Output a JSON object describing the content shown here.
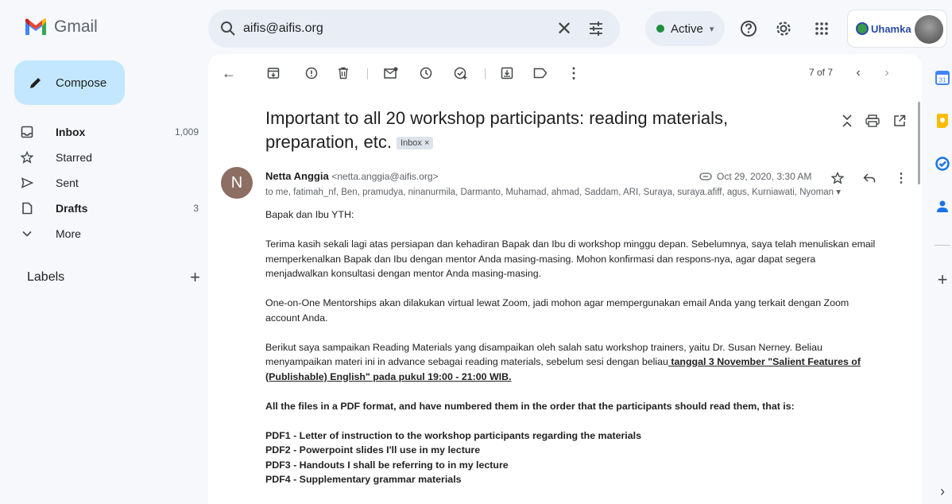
{
  "app": {
    "name": "Gmail"
  },
  "search": {
    "query": "aifis@aifis.org"
  },
  "status": {
    "label": "Active"
  },
  "account": {
    "org_logo_text": "Uhamka"
  },
  "sidebar": {
    "compose_label": "Compose",
    "items": [
      {
        "label": "Inbox",
        "count": "1,009",
        "icon": "inbox-icon"
      },
      {
        "label": "Starred",
        "count": "",
        "icon": "star-icon"
      },
      {
        "label": "Sent",
        "count": "",
        "icon": "send-icon"
      },
      {
        "label": "Drafts",
        "count": "3",
        "icon": "draft-icon"
      },
      {
        "label": "More",
        "count": "",
        "icon": "chevron-down-icon"
      }
    ],
    "labels_heading": "Labels"
  },
  "toolbar": {
    "pager": "7 of 7"
  },
  "email": {
    "subject_line1": "Important to all 20 workshop participants: reading materials,",
    "subject_line2": "preparation, etc.",
    "label_chip": "Inbox",
    "label_chip_close": "×",
    "sender_initial": "N",
    "sender_name": "Netta Anggia",
    "sender_email": "<netta.anggia@aifis.org>",
    "date": "Oct 29, 2020, 3:30 AM",
    "recipients": "to me, fatimah_nf, Ben, pramudya, ninanurmila, Darmanto, Muhamad, ahmad, Saddam, ARI, Suraya, suraya.afiff, agus, Kurniawati, Nyoman",
    "greeting": "Bapak dan Ibu YTH:",
    "p1_l1": "Terima kasih sekali lagi atas persiapan dan kehadiran Bapak dan Ibu di workshop minggu depan. Sebelumnya, saya telah menuliskan email",
    "p1_l2": "memperkenalkan Bapak dan Ibu dengan mentor Anda masing-masing. Mohon konfirmasi dan respons-nya, agar dapat segera",
    "p1_l3": "menjadwalkan konsultasi dengan mentor Anda masing-masing.",
    "p2_l1": "One-on-One Mentorships akan dilakukan virtual lewat Zoom, jadi mohon agar mempergunakan email Anda yang terkait dengan Zoom",
    "p2_l2": "account Anda.",
    "p3_l1": "Berikut saya sampaikan Reading Materials yang disampaikan oleh salah satu workshop trainers, yaitu Dr. Susan Nerney. Beliau",
    "p3_l2a": "menyampaikan materi ini in advance sebagai reading materials, sebelum sesi dengan beliau",
    "p3_l2b": " tanggal 3 November  \"Salient Features of",
    "p3_l3": "(Publishable) English\" pada pukul 19:00 - 21:00 WIB.",
    "p4": "All the files in a PDF format, and have numbered them in the order that the participants should read them, that is:",
    "pdfs": [
      "PDF1 - Letter of instruction to the workshop participants regarding the materials",
      "PDF2 - Powerpoint slides I'll use in my lecture",
      "PDF3 - Handouts I shall be referring to in my lecture",
      "PDF4 - Supplementary grammar materials"
    ]
  },
  "colors": {
    "compose_bg": "#c2e7ff",
    "active_dot": "#1e8e3e",
    "avatar_bg": "#8d6e63",
    "background": "#f6f8fc"
  }
}
